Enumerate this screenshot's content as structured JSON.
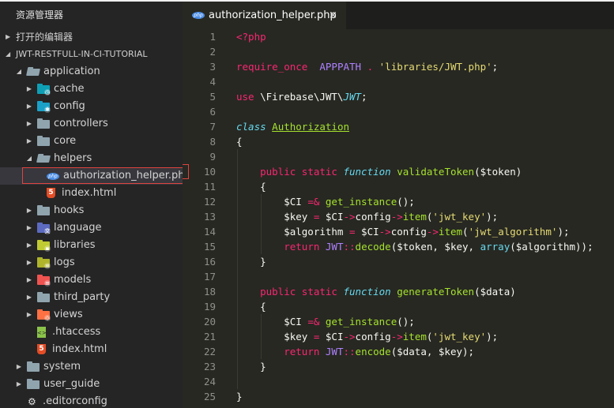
{
  "explorer": {
    "title": "资源管理器",
    "open_editors_label": "打开的编辑器",
    "project_label": "JWT-RESTFULL-IN-CI-TUTORIAL",
    "tree": [
      {
        "label": "application",
        "type": "folder",
        "expanded": true,
        "depth": 1,
        "icon": "folder-open-icon"
      },
      {
        "label": "cache",
        "type": "folder",
        "expanded": false,
        "depth": 2,
        "icon": "folder-cache-icon"
      },
      {
        "label": "config",
        "type": "folder",
        "expanded": false,
        "depth": 2,
        "icon": "folder-config-icon"
      },
      {
        "label": "controllers",
        "type": "folder",
        "expanded": false,
        "depth": 2,
        "icon": "folder-icon"
      },
      {
        "label": "core",
        "type": "folder",
        "expanded": false,
        "depth": 2,
        "icon": "folder-icon"
      },
      {
        "label": "helpers",
        "type": "folder",
        "expanded": true,
        "depth": 2,
        "icon": "folder-open-icon"
      },
      {
        "label": "authorization_helper.php",
        "type": "file",
        "depth": 3,
        "icon": "php-file-icon",
        "selected": true
      },
      {
        "label": "index.html",
        "type": "file",
        "depth": 3,
        "icon": "html5-file-icon"
      },
      {
        "label": "hooks",
        "type": "folder",
        "expanded": false,
        "depth": 2,
        "icon": "folder-icon"
      },
      {
        "label": "language",
        "type": "folder",
        "expanded": false,
        "depth": 2,
        "icon": "folder-language-icon"
      },
      {
        "label": "libraries",
        "type": "folder",
        "expanded": false,
        "depth": 2,
        "icon": "folder-libraries-icon"
      },
      {
        "label": "logs",
        "type": "folder",
        "expanded": false,
        "depth": 2,
        "icon": "folder-logs-icon"
      },
      {
        "label": "models",
        "type": "folder",
        "expanded": false,
        "depth": 2,
        "icon": "folder-models-icon"
      },
      {
        "label": "third_party",
        "type": "folder",
        "expanded": false,
        "depth": 2,
        "icon": "folder-icon"
      },
      {
        "label": "views",
        "type": "folder",
        "expanded": false,
        "depth": 2,
        "icon": "folder-views-icon"
      },
      {
        "label": ".htaccess",
        "type": "file",
        "depth": 2,
        "icon": "htaccess-file-icon"
      },
      {
        "label": "index.html",
        "type": "file",
        "depth": 2,
        "icon": "html5-file-icon"
      },
      {
        "label": "system",
        "type": "folder",
        "expanded": false,
        "depth": 1,
        "icon": "folder-icon"
      },
      {
        "label": "user_guide",
        "type": "folder",
        "expanded": false,
        "depth": 1,
        "icon": "folder-icon"
      },
      {
        "label": ".editorconfig",
        "type": "file",
        "depth": 1,
        "icon": "editorconfig-file-icon"
      }
    ]
  },
  "editor": {
    "tab": {
      "label": "authorization_helper.php",
      "icon": "php-file-icon",
      "close_glyph": "×"
    },
    "lines": [
      {
        "n": "1",
        "tokens": [
          [
            "kw",
            "<?php"
          ]
        ]
      },
      {
        "n": "2",
        "tokens": []
      },
      {
        "n": "3",
        "tokens": [
          [
            "kw",
            "require_once"
          ],
          [
            "",
            "  "
          ],
          [
            "cn",
            "APPPATH"
          ],
          [
            "",
            ""
          ],
          [
            "kw",
            " ."
          ],
          [
            "",
            " "
          ],
          [
            "st",
            "'libraries/JWT.php'"
          ],
          [
            "",
            ";"
          ]
        ]
      },
      {
        "n": "4",
        "tokens": []
      },
      {
        "n": "5",
        "tokens": [
          [
            "kw",
            "use"
          ],
          [
            "",
            " \\Firebase\\JWT\\"
          ],
          [
            "it",
            "JWT"
          ],
          [
            "",
            ";"
          ]
        ]
      },
      {
        "n": "6",
        "tokens": []
      },
      {
        "n": "7",
        "tokens": [
          [
            "it",
            "class"
          ],
          [
            "",
            " "
          ],
          [
            "ul",
            "Authorization"
          ]
        ]
      },
      {
        "n": "8",
        "tokens": [
          [
            "",
            "{"
          ]
        ]
      },
      {
        "n": "9",
        "tokens": []
      },
      {
        "n": "10",
        "tokens": [
          [
            "",
            "    "
          ],
          [
            "kw",
            "public"
          ],
          [
            "",
            " "
          ],
          [
            "kw",
            "static"
          ],
          [
            "",
            " "
          ],
          [
            "it",
            "function"
          ],
          [
            "",
            " "
          ],
          [
            "fn",
            "validateToken"
          ],
          [
            "",
            "($token)"
          ]
        ]
      },
      {
        "n": "11",
        "tokens": [
          [
            "",
            "    {"
          ]
        ]
      },
      {
        "n": "12",
        "tokens": [
          [
            "",
            "        $CI "
          ],
          [
            "kw",
            "=&"
          ],
          [
            "",
            " "
          ],
          [
            "fn",
            "get_instance"
          ],
          [
            "",
            "();"
          ]
        ]
      },
      {
        "n": "13",
        "tokens": [
          [
            "",
            "        $key "
          ],
          [
            "kw",
            "="
          ],
          [
            "",
            " $CI"
          ],
          [
            "kw",
            "->"
          ],
          [
            "",
            "config"
          ],
          [
            "kw",
            "->"
          ],
          [
            "fn",
            "item"
          ],
          [
            "",
            "("
          ],
          [
            "st",
            "'jwt_key'"
          ],
          [
            "",
            ");"
          ]
        ]
      },
      {
        "n": "14",
        "tokens": [
          [
            "",
            "        $algorithm "
          ],
          [
            "kw",
            "="
          ],
          [
            "",
            " $CI"
          ],
          [
            "kw",
            "->"
          ],
          [
            "",
            "config"
          ],
          [
            "kw",
            "->"
          ],
          [
            "fn",
            "item"
          ],
          [
            "",
            "("
          ],
          [
            "st",
            "'jwt_algorithm'"
          ],
          [
            "",
            ");"
          ]
        ]
      },
      {
        "n": "15",
        "tokens": [
          [
            "",
            "        "
          ],
          [
            "kw",
            "return"
          ],
          [
            "",
            " "
          ],
          [
            "cn",
            "JWT"
          ],
          [
            "kw",
            "::"
          ],
          [
            "fn",
            "decode"
          ],
          [
            "",
            "($token, $key, "
          ],
          [
            "bi",
            "array"
          ],
          [
            "",
            "($algorithm));"
          ]
        ]
      },
      {
        "n": "16",
        "tokens": [
          [
            "",
            "    }"
          ]
        ]
      },
      {
        "n": "17",
        "tokens": []
      },
      {
        "n": "18",
        "tokens": [
          [
            "",
            "    "
          ],
          [
            "kw",
            "public"
          ],
          [
            "",
            " "
          ],
          [
            "kw",
            "static"
          ],
          [
            "",
            " "
          ],
          [
            "it",
            "function"
          ],
          [
            "",
            " "
          ],
          [
            "fn",
            "generateToken"
          ],
          [
            "",
            "($data)"
          ]
        ]
      },
      {
        "n": "19",
        "tokens": [
          [
            "",
            "    {"
          ]
        ]
      },
      {
        "n": "20",
        "tokens": [
          [
            "",
            "        $CI "
          ],
          [
            "kw",
            "=&"
          ],
          [
            "",
            " "
          ],
          [
            "fn",
            "get_instance"
          ],
          [
            "",
            "();"
          ]
        ]
      },
      {
        "n": "21",
        "tokens": [
          [
            "",
            "        $key "
          ],
          [
            "kw",
            "="
          ],
          [
            "",
            " $CI"
          ],
          [
            "kw",
            "->"
          ],
          [
            "",
            "config"
          ],
          [
            "kw",
            "->"
          ],
          [
            "fn",
            "item"
          ],
          [
            "",
            "("
          ],
          [
            "st",
            "'jwt_key'"
          ],
          [
            "",
            ");"
          ]
        ]
      },
      {
        "n": "22",
        "tokens": [
          [
            "",
            "        "
          ],
          [
            "kw",
            "return"
          ],
          [
            "",
            " "
          ],
          [
            "cn",
            "JWT"
          ],
          [
            "kw",
            "::"
          ],
          [
            "fn",
            "encode"
          ],
          [
            "",
            "($data, $key);"
          ]
        ]
      },
      {
        "n": "23",
        "tokens": [
          [
            "",
            "    }"
          ]
        ]
      },
      {
        "n": "24",
        "tokens": []
      },
      {
        "n": "25",
        "tokens": [
          [
            "",
            "}"
          ]
        ]
      }
    ]
  }
}
